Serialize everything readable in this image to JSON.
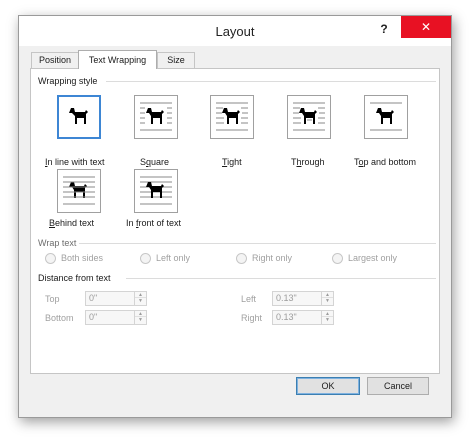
{
  "window": {
    "title": "Layout",
    "help": "?",
    "close": "✕"
  },
  "tabs": [
    {
      "label": "Position",
      "active": false
    },
    {
      "label": "Text Wrapping",
      "active": true
    },
    {
      "label": "Size",
      "active": false
    }
  ],
  "wrapping_style": {
    "heading": "Wrapping style",
    "selected": "In line with text",
    "options": [
      {
        "pre": "",
        "key": "I",
        "post": "n line with text"
      },
      {
        "pre": "S",
        "key": "q",
        "post": "uare"
      },
      {
        "pre": "",
        "key": "T",
        "post": "ight"
      },
      {
        "pre": "T",
        "key": "h",
        "post": "rough"
      },
      {
        "pre": "T",
        "key": "o",
        "post": "p and bottom"
      },
      {
        "pre": "",
        "key": "B",
        "post": "ehind text"
      },
      {
        "pre": "In ",
        "key": "f",
        "post": "ront of text"
      }
    ]
  },
  "wrap_text": {
    "heading": "Wrap text",
    "options": [
      "Both sides",
      "Left only",
      "Right only",
      "Largest only"
    ]
  },
  "distance": {
    "heading": "Distance from text",
    "fields": {
      "top": {
        "label": "Top",
        "value": "0\""
      },
      "bottom": {
        "label": "Bottom",
        "value": "0\""
      },
      "left": {
        "label": "Left",
        "value": "0.13\""
      },
      "right": {
        "label": "Right",
        "value": "0.13\""
      }
    },
    "spin_up": "▲",
    "spin_down": "▼"
  },
  "buttons": {
    "ok": "OK",
    "cancel": "Cancel"
  },
  "colors": {
    "close": "#e81123",
    "selection": "#3d86d4",
    "default_button_border": "#3c7fb1"
  }
}
